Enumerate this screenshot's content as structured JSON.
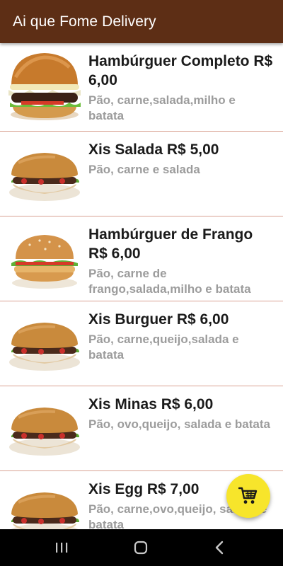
{
  "appbar": {
    "title": "Ai que Fome Delivery",
    "color": "#5d2e15"
  },
  "products": [
    {
      "name": "Hambúrguer Completo R$ 6,00",
      "description": "Pão, carne,salada,milho e batata",
      "image": "hamburger-image"
    },
    {
      "name": "Xis Salada R$ 5,00",
      "description": "Pão, carne e salada",
      "image": "xis-image"
    },
    {
      "name": "Hambúrguer de Frango R$ 6,00",
      "description": "Pão, carne de frango,salada,milho e batata",
      "image": "chicken-burger-image"
    },
    {
      "name": "Xis Burguer R$ 6,00",
      "description": "Pão, carne,queijo,salada e batata",
      "image": "xis-image"
    },
    {
      "name": "Xis Minas R$ 6,00",
      "description": "Pão, ovo,queijo, salada e batata",
      "image": "xis-image"
    },
    {
      "name": "Xis Egg R$ 7,00",
      "description": "Pão, carne,ovo,queijo, salada e batata",
      "image": "xis-image"
    }
  ],
  "fab": {
    "icon": "cart-icon",
    "color": "#f7e52b"
  },
  "navbar": {
    "icons": [
      "recent-apps-icon",
      "home-icon",
      "back-icon"
    ]
  }
}
